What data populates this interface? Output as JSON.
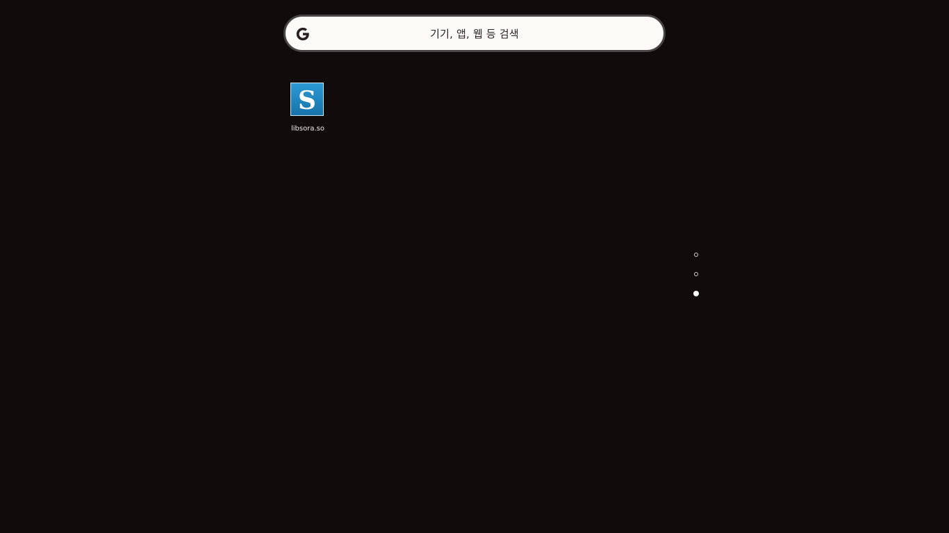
{
  "search": {
    "placeholder": "기기, 앱, 웹 등 검색",
    "logo_icon": "google-g-icon"
  },
  "apps": [
    {
      "label": "libsora.so",
      "icon": "libsora-s-icon"
    }
  ],
  "page_indicator": {
    "pages": 3,
    "current": 3
  },
  "colors": {
    "background": "#120b0c",
    "search_bg": "#fdfbf8",
    "search_border": "#4a4446",
    "icon_blue": "#1e88c8"
  }
}
